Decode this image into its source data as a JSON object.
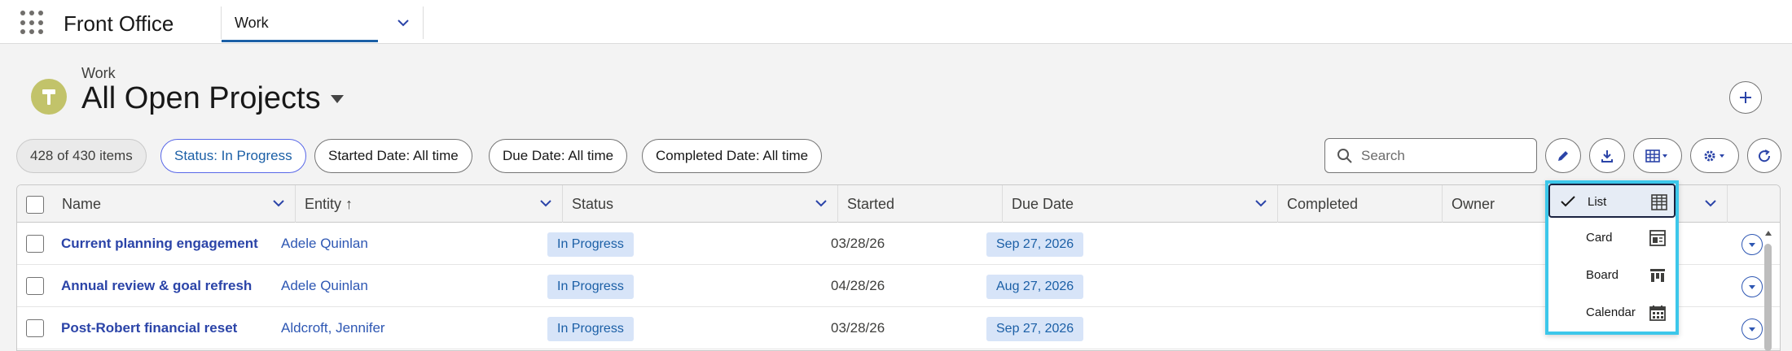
{
  "app": {
    "name": "Front Office",
    "nav_tab": "Work"
  },
  "header": {
    "object": "Work",
    "title": "All Open Projects"
  },
  "filters": {
    "count": "428 of 430 items",
    "pills": [
      {
        "key": "Status:",
        "value": " In Progress"
      },
      {
        "key": "Started Date:",
        "value": " All time"
      },
      {
        "key": "Due Date:",
        "value": " All time"
      },
      {
        "key": "Completed Date:",
        "value": " All time"
      }
    ]
  },
  "search": {
    "placeholder": "Search"
  },
  "table": {
    "columns": [
      "Name",
      "Entity",
      "Status",
      "Started",
      "Due Date",
      "Completed",
      "Owner"
    ],
    "sort_indicator": "↑",
    "rows": [
      {
        "name": "Current planning engagement",
        "entity": "Adele Quinlan",
        "status": "In Progress",
        "started": "03/28/26",
        "due": "Sep 27, 2026",
        "completed": "",
        "owner": ""
      },
      {
        "name": "Annual review & goal refresh",
        "entity": "Adele Quinlan",
        "status": "In Progress",
        "started": "04/28/26",
        "due": "Aug 27, 2026",
        "completed": "",
        "owner": ""
      },
      {
        "name": "Post-Robert financial reset",
        "entity": "Aldcroft, Jennifer",
        "status": "In Progress",
        "started": "03/28/26",
        "due": "Sep 27, 2026",
        "completed": "",
        "owner": ""
      }
    ]
  },
  "view_menu": {
    "items": [
      {
        "label": "List",
        "icon": "table-icon",
        "selected": true
      },
      {
        "label": "Card",
        "icon": "card-icon",
        "selected": false
      },
      {
        "label": "Board",
        "icon": "board-icon",
        "selected": false
      },
      {
        "label": "Calendar",
        "icon": "calendar-icon",
        "selected": false
      }
    ]
  },
  "colors": {
    "accent": "#1b5fa6",
    "link": "#2b44a8",
    "badge_bg": "#d7e4f8",
    "highlight": "#3cc7ea",
    "header_icon": "#c2c36a"
  }
}
